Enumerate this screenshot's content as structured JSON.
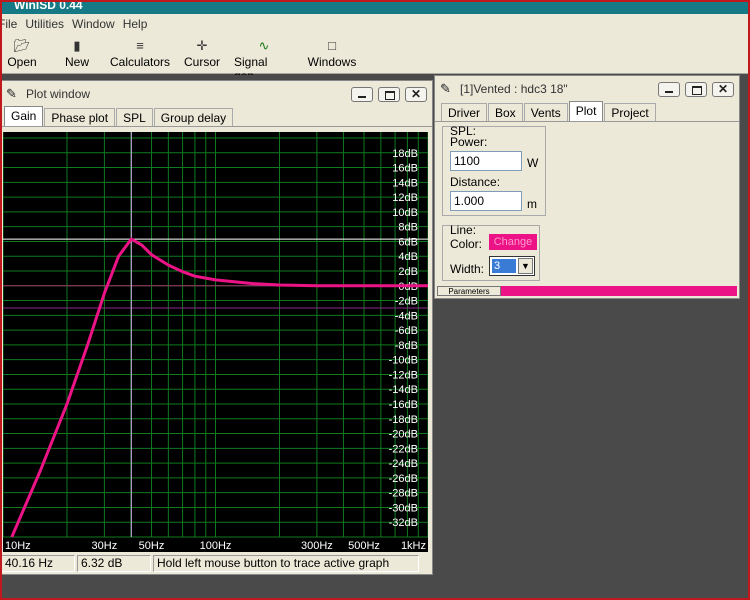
{
  "app": {
    "title": "WinISD 0.44"
  },
  "menu": [
    "File",
    "Utilities",
    "Window",
    "Help"
  ],
  "toolbar": [
    {
      "label": "Open",
      "icon": "open-folder-icon"
    },
    {
      "label": "New",
      "icon": "new-document-icon"
    },
    {
      "label": "Calculators",
      "icon": "calculator-icon"
    },
    {
      "label": "Cursor",
      "icon": "crosshair-cursor-icon"
    },
    {
      "label": "Signal gen.",
      "icon": "sine-wave-icon"
    },
    {
      "label": "Windows",
      "icon": "window-icon"
    }
  ],
  "plot_window": {
    "title": "Plot window",
    "tabs": [
      "Gain",
      "Phase plot",
      "SPL",
      "Group delay"
    ],
    "active_tab": "Gain",
    "status": {
      "frequency": "40.16 Hz",
      "gain": "6.32 dB",
      "hint": "Hold left mouse button to trace active graph"
    }
  },
  "param_window": {
    "title": "[1]Vented : hdc3 18\"",
    "tabs": [
      "Driver",
      "Box",
      "Vents",
      "Plot",
      "Project"
    ],
    "active_tab": "Plot",
    "spl": {
      "group_label": "SPL:",
      "power_label": "Power:",
      "power_value": "1100",
      "power_unit": "W",
      "distance_label": "Distance:",
      "distance_value": "1.000",
      "distance_unit": "m"
    },
    "line": {
      "group_label": "Line:",
      "color_label": "Color:",
      "color_button": "Change",
      "width_label": "Width:",
      "width_value": "3"
    },
    "panel_label": "Parameters"
  },
  "colors": {
    "curve": "#ec1387",
    "grid": "#0f7a1e",
    "plot_bg": "#000000",
    "titlebar": "#157a86"
  },
  "chart_data": {
    "type": "line",
    "xscale": "log",
    "xlim": [
      10,
      1000
    ],
    "ylim": [
      -34,
      20
    ],
    "x_ticks": [
      "10Hz",
      "30Hz",
      "50Hz",
      "100Hz",
      "300Hz",
      "500Hz",
      "1kHz"
    ],
    "y_ticks": [
      "18dB",
      "16dB",
      "14dB",
      "12dB",
      "10dB",
      "8dB",
      "6dB",
      "4dB",
      "2dB",
      "0dB",
      "-2dB",
      "-4dB",
      "-6dB",
      "-8dB",
      "-10dB",
      "-12dB",
      "-14dB",
      "-16dB",
      "-18dB",
      "-20dB",
      "-22dB",
      "-24dB",
      "-26dB",
      "-28dB",
      "-30dB",
      "-32dB"
    ],
    "grid": true,
    "cursor": {
      "x": 40.16,
      "y": 6.32
    },
    "series": [
      {
        "color": "#ec1387",
        "x": [
          11,
          15,
          20,
          25,
          30,
          35,
          40.16,
          45,
          50,
          60,
          70,
          80,
          100,
          150,
          200,
          300,
          500,
          1000
        ],
        "y": [
          -34,
          -25,
          -16,
          -8,
          -1,
          4,
          6.32,
          5.5,
          4.2,
          2.8,
          1.9,
          1.3,
          0.8,
          0.3,
          0.1,
          0,
          0,
          0
        ]
      }
    ]
  }
}
